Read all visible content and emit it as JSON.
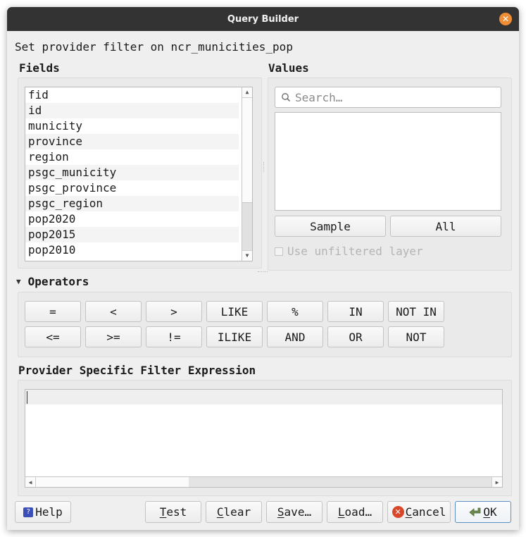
{
  "window": {
    "title": "Query Builder",
    "close_icon": "close-icon"
  },
  "subtitle": "Set provider filter on ncr_municities_pop",
  "fields": {
    "label": "Fields",
    "items": [
      "fid",
      "id",
      "municity",
      "province",
      "region",
      "psgc_municity",
      "psgc_province",
      "psgc_region",
      "pop2020",
      "pop2015",
      "pop2010"
    ],
    "scroll_position": "bottom"
  },
  "values": {
    "label": "Values",
    "search_placeholder": "Search…",
    "search_value": "",
    "items": [],
    "sample_label": "Sample",
    "all_label": "All",
    "use_unfiltered_label": "Use unfiltered layer",
    "use_unfiltered_checked": false,
    "use_unfiltered_enabled": false
  },
  "operators": {
    "label": "Operators",
    "expanded": true,
    "row1": [
      "=",
      "<",
      ">",
      "LIKE",
      "%",
      "IN",
      "NOT IN"
    ],
    "row2": [
      "<=",
      ">=",
      "!=",
      "ILIKE",
      "AND",
      "OR",
      "NOT"
    ]
  },
  "expression": {
    "label": "Provider Specific Filter Expression",
    "value": ""
  },
  "buttons": {
    "help": {
      "label": "Help",
      "icon": "help-icon"
    },
    "test": {
      "mnemonic": "T",
      "rest": "est"
    },
    "clear": {
      "mnemonic": "C",
      "rest": "lear"
    },
    "save": {
      "mnemonic": "S",
      "rest": "ave…"
    },
    "load": {
      "mnemonic": "L",
      "rest": "oad…"
    },
    "cancel": {
      "mnemonic": "C",
      "rest": "ancel",
      "icon": "cancel-icon"
    },
    "ok": {
      "mnemonic": "O",
      "rest": "K",
      "icon": "ok-arrow-icon",
      "is_default": true
    }
  },
  "colors": {
    "titlebar": "#333333",
    "close_button": "#f08e38",
    "default_button_border": "#5f8ec2",
    "help_icon": "#3b4fb8",
    "cancel_icon": "#d9472b",
    "ok_icon": "#6b8a4e"
  }
}
